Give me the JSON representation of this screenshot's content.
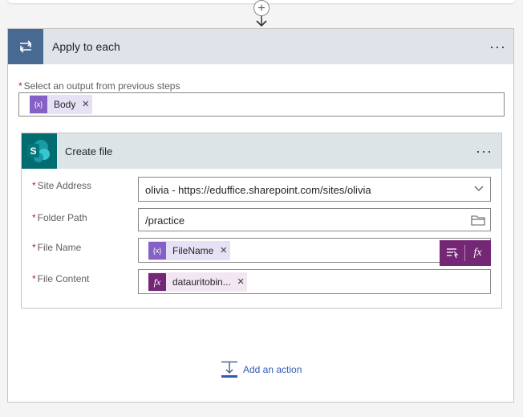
{
  "loop": {
    "title": "Apply to each",
    "more_label": "···",
    "select_output_label": "Select an output from previous steps",
    "required_mark": "*",
    "output_token": {
      "label": "Body",
      "icon": "expression-icon",
      "remove": "×"
    }
  },
  "action": {
    "title": "Create file",
    "more_label": "···",
    "icon": "sharepoint-icon",
    "fields": {
      "site_address": {
        "label": "Site Address",
        "value": "olivia - https://eduffice.sharepoint.com/sites/olivia"
      },
      "folder_path": {
        "label": "Folder Path",
        "value": "/practice"
      },
      "file_name": {
        "label": "File Name",
        "token": "FileName",
        "remove": "×"
      },
      "file_content": {
        "label": "File Content",
        "token": "datauritobin...",
        "remove": "×"
      }
    },
    "fx_label": "fx"
  },
  "add_action": {
    "label": "Add an action"
  },
  "colors": {
    "loop_header": "#486991",
    "sharepoint": "#036c70",
    "token_variable": "#8661c5",
    "token_expression": "#742774",
    "link": "#2f5bb7"
  }
}
